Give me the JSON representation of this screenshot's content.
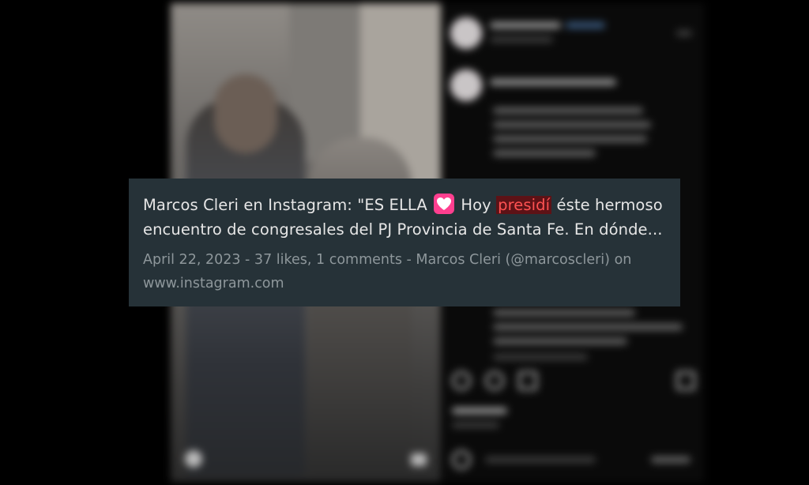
{
  "preview": {
    "title_part1": "Marcos Cleri en Instagram: \"ES ELLA",
    "title_part2": "Hoy",
    "title_highlight": "presidí",
    "title_part3": "éste hermoso encuentro de congresales del PJ Provincia de Santa Fe. En dónde...",
    "heart_emoji": "heart-emoji",
    "meta_line1": "April 22, 2023 - 37 likes, 1 comments - Marcos Cleri (@marcoscleri) on",
    "meta_line2": "www.instagram.com"
  },
  "colors": {
    "card_bg": "#263238",
    "highlight_bg": "#5d1216",
    "highlight_text": "#ff5252",
    "emoji_bg": "#ff3f8f"
  }
}
